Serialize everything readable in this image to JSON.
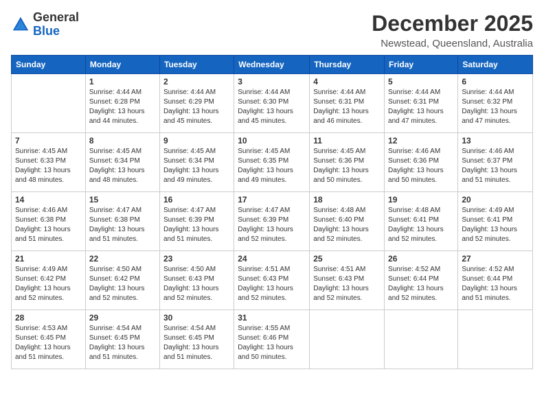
{
  "header": {
    "logo_line1": "General",
    "logo_line2": "Blue",
    "month": "December 2025",
    "location": "Newstead, Queensland, Australia"
  },
  "weekdays": [
    "Sunday",
    "Monday",
    "Tuesday",
    "Wednesday",
    "Thursday",
    "Friday",
    "Saturday"
  ],
  "weeks": [
    [
      {
        "day": "",
        "sunrise": "",
        "sunset": "",
        "daylight": ""
      },
      {
        "day": "1",
        "sunrise": "Sunrise: 4:44 AM",
        "sunset": "Sunset: 6:28 PM",
        "daylight": "Daylight: 13 hours and 44 minutes."
      },
      {
        "day": "2",
        "sunrise": "Sunrise: 4:44 AM",
        "sunset": "Sunset: 6:29 PM",
        "daylight": "Daylight: 13 hours and 45 minutes."
      },
      {
        "day": "3",
        "sunrise": "Sunrise: 4:44 AM",
        "sunset": "Sunset: 6:30 PM",
        "daylight": "Daylight: 13 hours and 45 minutes."
      },
      {
        "day": "4",
        "sunrise": "Sunrise: 4:44 AM",
        "sunset": "Sunset: 6:31 PM",
        "daylight": "Daylight: 13 hours and 46 minutes."
      },
      {
        "day": "5",
        "sunrise": "Sunrise: 4:44 AM",
        "sunset": "Sunset: 6:31 PM",
        "daylight": "Daylight: 13 hours and 47 minutes."
      },
      {
        "day": "6",
        "sunrise": "Sunrise: 4:44 AM",
        "sunset": "Sunset: 6:32 PM",
        "daylight": "Daylight: 13 hours and 47 minutes."
      }
    ],
    [
      {
        "day": "7",
        "sunrise": "Sunrise: 4:45 AM",
        "sunset": "Sunset: 6:33 PM",
        "daylight": "Daylight: 13 hours and 48 minutes."
      },
      {
        "day": "8",
        "sunrise": "Sunrise: 4:45 AM",
        "sunset": "Sunset: 6:34 PM",
        "daylight": "Daylight: 13 hours and 48 minutes."
      },
      {
        "day": "9",
        "sunrise": "Sunrise: 4:45 AM",
        "sunset": "Sunset: 6:34 PM",
        "daylight": "Daylight: 13 hours and 49 minutes."
      },
      {
        "day": "10",
        "sunrise": "Sunrise: 4:45 AM",
        "sunset": "Sunset: 6:35 PM",
        "daylight": "Daylight: 13 hours and 49 minutes."
      },
      {
        "day": "11",
        "sunrise": "Sunrise: 4:45 AM",
        "sunset": "Sunset: 6:36 PM",
        "daylight": "Daylight: 13 hours and 50 minutes."
      },
      {
        "day": "12",
        "sunrise": "Sunrise: 4:46 AM",
        "sunset": "Sunset: 6:36 PM",
        "daylight": "Daylight: 13 hours and 50 minutes."
      },
      {
        "day": "13",
        "sunrise": "Sunrise: 4:46 AM",
        "sunset": "Sunset: 6:37 PM",
        "daylight": "Daylight: 13 hours and 51 minutes."
      }
    ],
    [
      {
        "day": "14",
        "sunrise": "Sunrise: 4:46 AM",
        "sunset": "Sunset: 6:38 PM",
        "daylight": "Daylight: 13 hours and 51 minutes."
      },
      {
        "day": "15",
        "sunrise": "Sunrise: 4:47 AM",
        "sunset": "Sunset: 6:38 PM",
        "daylight": "Daylight: 13 hours and 51 minutes."
      },
      {
        "day": "16",
        "sunrise": "Sunrise: 4:47 AM",
        "sunset": "Sunset: 6:39 PM",
        "daylight": "Daylight: 13 hours and 51 minutes."
      },
      {
        "day": "17",
        "sunrise": "Sunrise: 4:47 AM",
        "sunset": "Sunset: 6:39 PM",
        "daylight": "Daylight: 13 hours and 52 minutes."
      },
      {
        "day": "18",
        "sunrise": "Sunrise: 4:48 AM",
        "sunset": "Sunset: 6:40 PM",
        "daylight": "Daylight: 13 hours and 52 minutes."
      },
      {
        "day": "19",
        "sunrise": "Sunrise: 4:48 AM",
        "sunset": "Sunset: 6:41 PM",
        "daylight": "Daylight: 13 hours and 52 minutes."
      },
      {
        "day": "20",
        "sunrise": "Sunrise: 4:49 AM",
        "sunset": "Sunset: 6:41 PM",
        "daylight": "Daylight: 13 hours and 52 minutes."
      }
    ],
    [
      {
        "day": "21",
        "sunrise": "Sunrise: 4:49 AM",
        "sunset": "Sunset: 6:42 PM",
        "daylight": "Daylight: 13 hours and 52 minutes."
      },
      {
        "day": "22",
        "sunrise": "Sunrise: 4:50 AM",
        "sunset": "Sunset: 6:42 PM",
        "daylight": "Daylight: 13 hours and 52 minutes."
      },
      {
        "day": "23",
        "sunrise": "Sunrise: 4:50 AM",
        "sunset": "Sunset: 6:43 PM",
        "daylight": "Daylight: 13 hours and 52 minutes."
      },
      {
        "day": "24",
        "sunrise": "Sunrise: 4:51 AM",
        "sunset": "Sunset: 6:43 PM",
        "daylight": "Daylight: 13 hours and 52 minutes."
      },
      {
        "day": "25",
        "sunrise": "Sunrise: 4:51 AM",
        "sunset": "Sunset: 6:43 PM",
        "daylight": "Daylight: 13 hours and 52 minutes."
      },
      {
        "day": "26",
        "sunrise": "Sunrise: 4:52 AM",
        "sunset": "Sunset: 6:44 PM",
        "daylight": "Daylight: 13 hours and 52 minutes."
      },
      {
        "day": "27",
        "sunrise": "Sunrise: 4:52 AM",
        "sunset": "Sunset: 6:44 PM",
        "daylight": "Daylight: 13 hours and 51 minutes."
      }
    ],
    [
      {
        "day": "28",
        "sunrise": "Sunrise: 4:53 AM",
        "sunset": "Sunset: 6:45 PM",
        "daylight": "Daylight: 13 hours and 51 minutes."
      },
      {
        "day": "29",
        "sunrise": "Sunrise: 4:54 AM",
        "sunset": "Sunset: 6:45 PM",
        "daylight": "Daylight: 13 hours and 51 minutes."
      },
      {
        "day": "30",
        "sunrise": "Sunrise: 4:54 AM",
        "sunset": "Sunset: 6:45 PM",
        "daylight": "Daylight: 13 hours and 51 minutes."
      },
      {
        "day": "31",
        "sunrise": "Sunrise: 4:55 AM",
        "sunset": "Sunset: 6:46 PM",
        "daylight": "Daylight: 13 hours and 50 minutes."
      },
      {
        "day": "",
        "sunrise": "",
        "sunset": "",
        "daylight": ""
      },
      {
        "day": "",
        "sunrise": "",
        "sunset": "",
        "daylight": ""
      },
      {
        "day": "",
        "sunrise": "",
        "sunset": "",
        "daylight": ""
      }
    ]
  ]
}
